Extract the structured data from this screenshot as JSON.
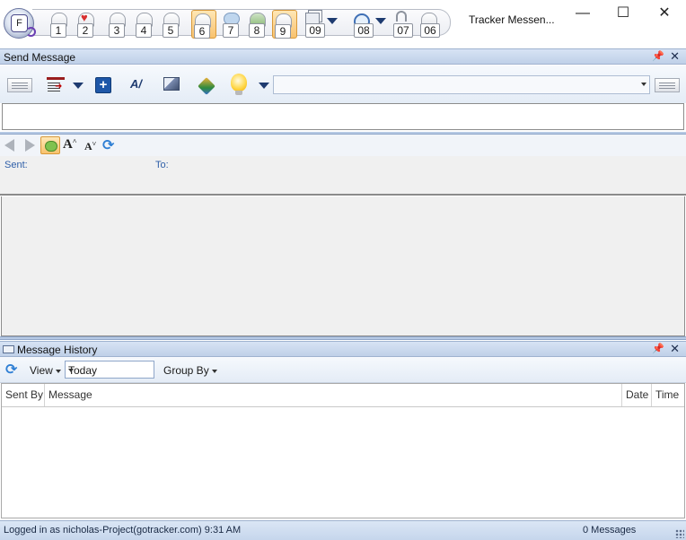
{
  "window": {
    "title": "Tracker Messen...",
    "minimize_glyph": "—",
    "maximize_glyph": "☐",
    "close_glyph": "✕"
  },
  "app_button": {
    "letter": "F"
  },
  "quick_access": [
    {
      "badge": "1"
    },
    {
      "badge": "2"
    },
    {
      "badge": "3"
    },
    {
      "badge": "4"
    },
    {
      "badge": "5"
    },
    {
      "badge": "6"
    },
    {
      "badge": "7"
    },
    {
      "badge": "8"
    },
    {
      "badge": "9"
    },
    {
      "badge": "09"
    },
    {
      "badge": "08"
    },
    {
      "badge": "07"
    },
    {
      "badge": "06"
    }
  ],
  "send_pane": {
    "title": "Send Message",
    "pin_glyph": "📌",
    "close_glyph": "✕",
    "template_value": "",
    "compose_value": ""
  },
  "reader": {
    "sent_label": "Sent:",
    "to_label": "To:",
    "sent_value": "",
    "to_value": "",
    "font_increase": "A",
    "font_decrease": "A"
  },
  "history_pane": {
    "title": "Message History",
    "pin_glyph": "📌",
    "close_glyph": "✕",
    "view_label": "View",
    "date_filter": "Today",
    "group_label": "Group By",
    "columns": [
      "Sent By",
      "Message",
      "Date",
      "Time"
    ]
  },
  "status": {
    "left": "Logged in as nicholas-Project(gotracker.com) 9:31 AM",
    "right": "0 Messages"
  },
  "colors": {
    "pane_header": "#bfd0e8",
    "field_label": "#2f5fa8",
    "active_tool": "#f8c26e",
    "status_bar": "#c6d6ec"
  }
}
